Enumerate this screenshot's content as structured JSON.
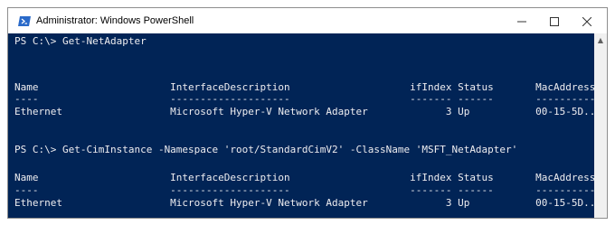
{
  "window": {
    "title": "Administrator: Windows PowerShell",
    "controls": {
      "minimize": "—",
      "maximize": "☐",
      "close": "✕"
    }
  },
  "console": {
    "lines": [
      "PS C:\\> Get-NetAdapter",
      "",
      "Name                      InterfaceDescription                    ifIndex Status       MacAddress",
      "----                      --------------------                    ------- ------       ----------",
      "Ethernet                  Microsoft Hyper-V Network Adapter             3 Up           00-15-5D...",
      "",
      "",
      "PS C:\\> Get-CimInstance -Namespace 'root/StandardCimV2' -ClassName 'MSFT_NetAdapter'",
      "",
      "Name                      InterfaceDescription                    ifIndex Status       MacAddress",
      "----                      --------------------                    ------- ------       ----------",
      "Ethernet                  Microsoft Hyper-V Network Adapter             3 Up           00-15-5D..."
    ]
  },
  "scrollbar": {
    "up_arrow": "▲"
  },
  "colors": {
    "console_background": "#012456",
    "console_text": "#eeedf0",
    "titlebar_background": "#ffffff"
  },
  "icons": [
    "powershell-icon",
    "minimize-icon",
    "maximize-icon",
    "close-icon",
    "scroll-up-arrow-icon"
  ]
}
